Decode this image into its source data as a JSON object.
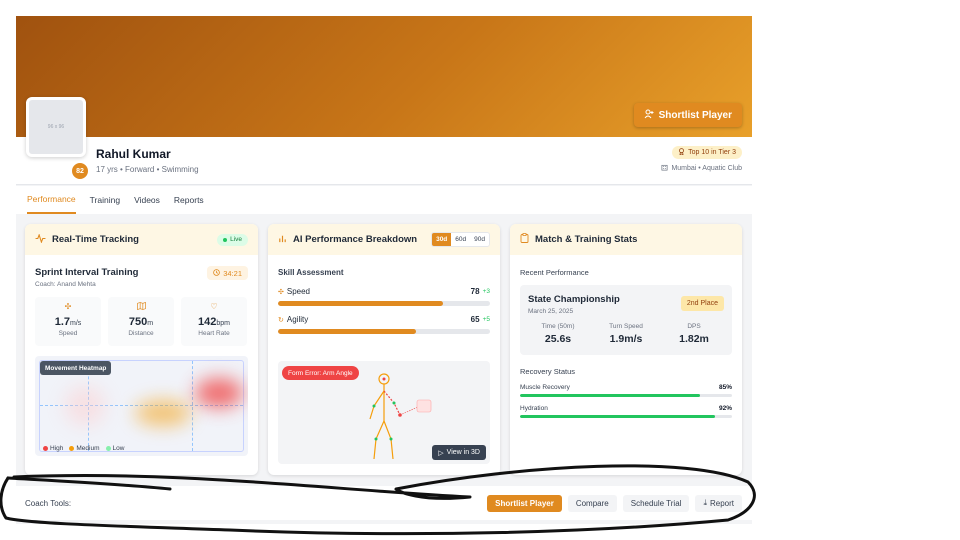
{
  "header": {
    "shortlist_label": "Shortlist Player",
    "avatar_text": "96 x 96",
    "rating": "82",
    "name": "Rahul Kumar",
    "meta": "17 yrs • Forward • Swimming",
    "tier_badge": "Top 10 in Tier 3",
    "club": "Mumbai • Aquatic Club"
  },
  "tabs": [
    {
      "label": "Performance",
      "active": true
    },
    {
      "label": "Training"
    },
    {
      "label": "Videos"
    },
    {
      "label": "Reports"
    }
  ],
  "tracking": {
    "title": "Real-Time Tracking",
    "live": "Live",
    "session": "Sprint Interval Training",
    "coach": "Coach: Anand Mehta",
    "timer": "34:21",
    "stats": [
      {
        "value": "1.7",
        "unit": "m/s",
        "label": "Speed"
      },
      {
        "value": "750",
        "unit": "m",
        "label": "Distance"
      },
      {
        "value": "142",
        "unit": "bpm",
        "label": "Heart Rate"
      }
    ],
    "heatmap_label": "Movement Heatmap",
    "legend": {
      "high": "High",
      "medium": "Medium",
      "low": "Low"
    },
    "colors": {
      "high": "#ef4444",
      "medium": "#f59e0b",
      "low": "#86efac"
    }
  },
  "breakdown": {
    "title": "AI Performance Breakdown",
    "ranges": [
      "30d",
      "60d",
      "90d"
    ],
    "active_range": "30d",
    "section": "Skill Assessment",
    "skills": [
      {
        "name": "Speed",
        "value": "78",
        "delta": "+3",
        "fill": 0.78
      },
      {
        "name": "Agility",
        "value": "65",
        "delta": "+5",
        "fill": 0.65
      }
    ],
    "error_label": "Form Error: Arm Angle",
    "view3d": "View in 3D"
  },
  "stats": {
    "title": "Match & Training Stats",
    "recent_title": "Recent Performance",
    "match_title": "State Championship",
    "match_date": "March 25, 2025",
    "place": "2nd Place",
    "metrics": [
      {
        "label": "Time (50m)",
        "value": "25.6s"
      },
      {
        "label": "Turn Speed",
        "value": "1.9m/s"
      },
      {
        "label": "DPS",
        "value": "1.82m"
      }
    ],
    "recovery_title": "Recovery Status",
    "recovery": [
      {
        "label": "Muscle Recovery",
        "pct": "85%",
        "fill": 0.85
      },
      {
        "label": "Hydration",
        "pct": "92%",
        "fill": 0.92
      }
    ]
  },
  "tools": {
    "label": "Coach Tools:",
    "shortlist": "Shortlist Player",
    "compare": "Compare",
    "schedule": "Schedule Trial",
    "report": "Report"
  },
  "accent": "#e08a20"
}
